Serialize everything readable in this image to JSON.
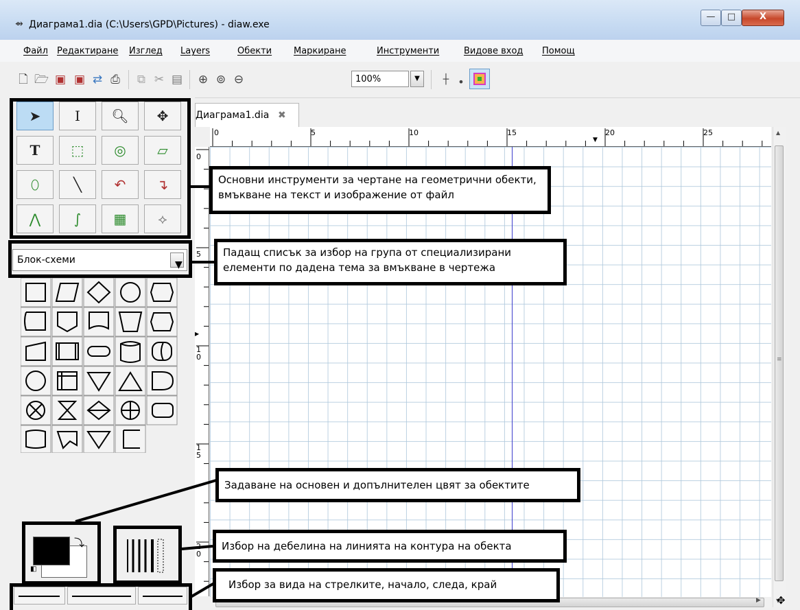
{
  "window": {
    "title": "Диаграма1.dia (C:\\Users\\GPD\\Pictures) - diaw.exe",
    "min_label": "—",
    "max_label": "□",
    "close_label": "X"
  },
  "menu": [
    "Файл",
    "Редактиране",
    "Изглед",
    "Layers",
    "Обекти",
    "Маркиране",
    "Инструменти",
    "Видове вход",
    "Помощ"
  ],
  "toolbar": {
    "zoom_value": "100%"
  },
  "tab": {
    "label": "Диаграма1.dia",
    "close_icon": "✖"
  },
  "sheet_selector": {
    "value": "Блок-схеми"
  },
  "ruler": {
    "h_labels": [
      "0",
      "5",
      "10",
      "15",
      "20",
      "25"
    ],
    "v_labels": [
      "0",
      "5",
      "1\n0",
      "1\n5",
      "2\n0"
    ]
  },
  "annotations": {
    "tools": "Основни инструменти за чертане на геометрични обекти, вмъкване на текст и изображение от файл",
    "sheet": "Падащ списък за избор на група от специализирани елементи по дадена тема за вмъкване в чертежа",
    "colors": "Задаване на основен и допълнителен цвят за обектите",
    "lines": "Избор на дебелина на линията на контура на обекта",
    "arrows": "Избор за вида на стрелките, начало, следа, край"
  },
  "colors": {
    "foreground": "#000000",
    "background": "#ffffff",
    "grid": "#afc8dc",
    "guide": "#3c3ccc",
    "tool_selected": "#bcdcf4"
  }
}
